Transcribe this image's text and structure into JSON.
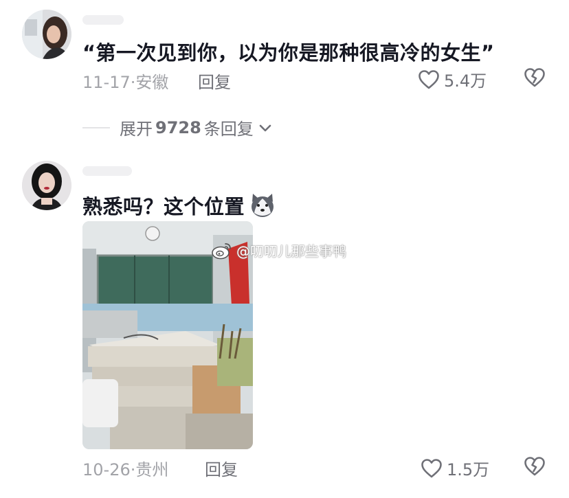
{
  "comments": [
    {
      "text": "“第一次见到你，以为你是那种很高冷的女生”",
      "date": "11-17",
      "location": "安徽",
      "reply_label": "回复",
      "likes": "5.4万",
      "expand": {
        "prefix": "展开",
        "count": "9728",
        "suffix": "条回复",
        "icon": "chevron-down-icon"
      }
    },
    {
      "text": "熟悉吗？这个位置",
      "emoji": "dog-face-emoji",
      "date": "10-26",
      "location": "贵州",
      "reply_label": "回复",
      "likes": "1.5万",
      "watermark": "@叨叨儿那些事鸭"
    }
  ],
  "icons": {
    "like": "heart-outline-icon",
    "dislike": "broken-heart-icon",
    "watermark_logo": "weibo-logo-icon"
  },
  "colors": {
    "text_primary": "#161823",
    "text_meta": "#a2a3a8",
    "text_secondary": "#6f7077",
    "background": "#ffffff"
  }
}
